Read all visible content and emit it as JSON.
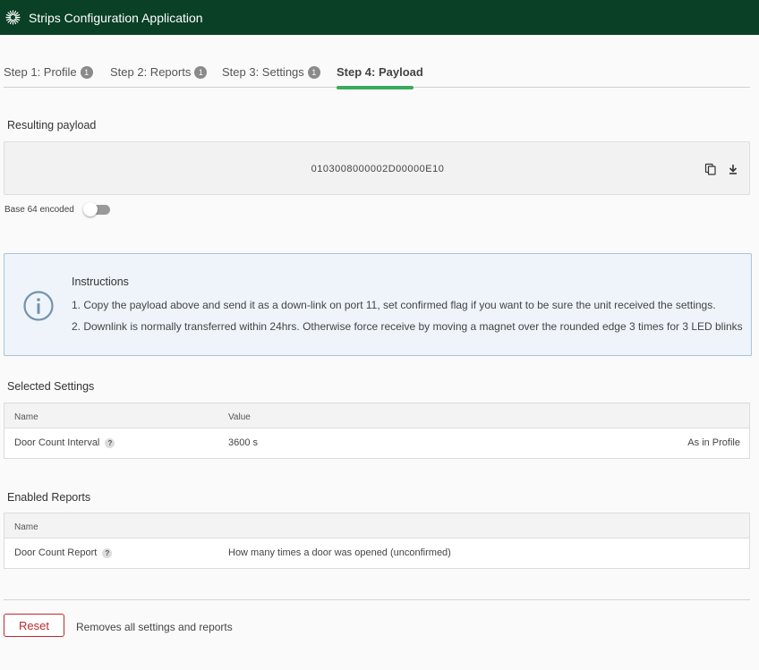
{
  "app": {
    "title": "Strips Configuration Application"
  },
  "tabs": [
    {
      "label": "Step 1: Profile",
      "badge": "1"
    },
    {
      "label": "Step 2: Reports",
      "badge": "1"
    },
    {
      "label": "Step 3: Settings",
      "badge": "1"
    },
    {
      "label": "Step 4: Payload",
      "badge": ""
    }
  ],
  "payload": {
    "section_title": "Resulting payload",
    "value": "0103008000002D00000E10",
    "toggle_label": "Base 64 encoded",
    "base64_enabled": false
  },
  "instructions": {
    "title": "Instructions",
    "lines": [
      "1. Copy the payload above and send it as a down-link on port 11, set confirmed flag if you want to be sure the unit received the settings.",
      "2. Downlink is normally transferred within 24hrs. Otherwise force receive by moving a magnet over the rounded edge 3 times for 3 LED blinks"
    ]
  },
  "selected_settings": {
    "title": "Selected Settings",
    "columns": [
      "Name",
      "Value"
    ],
    "rows": [
      {
        "name": "Door Count Interval",
        "value": "3600 s",
        "source": "As in Profile"
      }
    ]
  },
  "enabled_reports": {
    "title": "Enabled Reports",
    "columns": [
      "Name"
    ],
    "rows": [
      {
        "name": "Door Count Report",
        "description": "How many times a door was opened (unconfirmed)"
      }
    ]
  },
  "footer": {
    "reset_label": "Reset",
    "reset_description": "Removes all settings and reports"
  },
  "colors": {
    "header_bg": "#0a4026",
    "active_tab_underline": "#3aaa5c",
    "reset": "#c0282b",
    "info_border": "#a9c3dc",
    "info_bg": "#eef4fa"
  }
}
